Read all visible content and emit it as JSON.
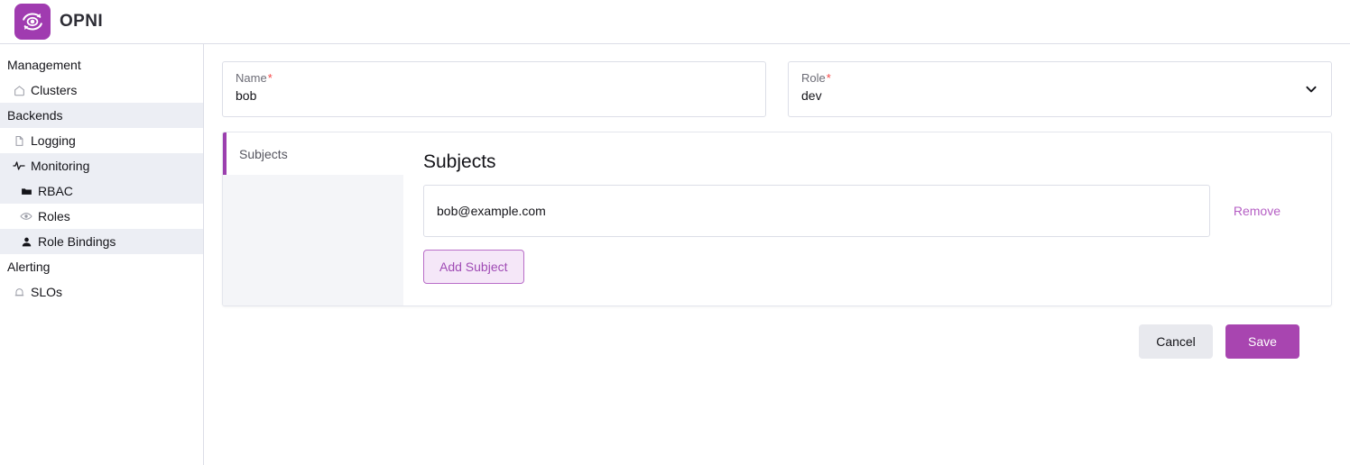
{
  "header": {
    "brand_name": "OPNI",
    "logo_icon": "opni-eye-refresh-icon",
    "brand_color": "#a03bb0"
  },
  "sidebar": {
    "groups": [
      {
        "label": "Management",
        "shaded": false,
        "items": [
          {
            "label": "Clusters",
            "icon": "home-icon",
            "indent": 1,
            "shaded": false,
            "active": false
          }
        ]
      },
      {
        "label": "Backends",
        "shaded": true,
        "items": [
          {
            "label": "Logging",
            "icon": "file-icon",
            "indent": 1,
            "shaded": false,
            "active": false
          },
          {
            "label": "Monitoring",
            "icon": "activity-pulse-icon",
            "indent": 1,
            "shaded": true,
            "active": false
          },
          {
            "label": "RBAC",
            "icon": "folder-icon",
            "indent": 2,
            "shaded": true,
            "active": false
          },
          {
            "label": "Roles",
            "icon": "eye-icon",
            "indent": 2,
            "shaded": false,
            "active": false
          },
          {
            "label": "Role Bindings",
            "icon": "user-icon",
            "indent": 2,
            "shaded": true,
            "active": true
          }
        ]
      },
      {
        "label": "Alerting",
        "shaded": false,
        "items": [
          {
            "label": "SLOs",
            "icon": "bell-icon",
            "indent": 1,
            "shaded": false,
            "active": false
          }
        ]
      }
    ]
  },
  "form": {
    "name_field": {
      "label": "Name",
      "required_marker": "*",
      "value": "bob",
      "placeholder": "Name"
    },
    "role_field": {
      "label": "Role",
      "required_marker": "*",
      "value": "dev",
      "chevron_icon": "chevron-down-icon"
    }
  },
  "tab_card": {
    "tabs": [
      {
        "label": "Subjects",
        "active": true
      }
    ],
    "panel": {
      "title": "Subjects",
      "subjects": [
        {
          "value": "bob@example.com",
          "placeholder": "",
          "remove_label": "Remove"
        }
      ],
      "add_button_label": "Add Subject"
    }
  },
  "actions": {
    "cancel_label": "Cancel",
    "save_label": "Save"
  },
  "colors": {
    "accent_purple": "#a845b0",
    "tab_accent": "#9b3fae",
    "link_purple": "#b55fc4",
    "required_red": "#f64747"
  }
}
